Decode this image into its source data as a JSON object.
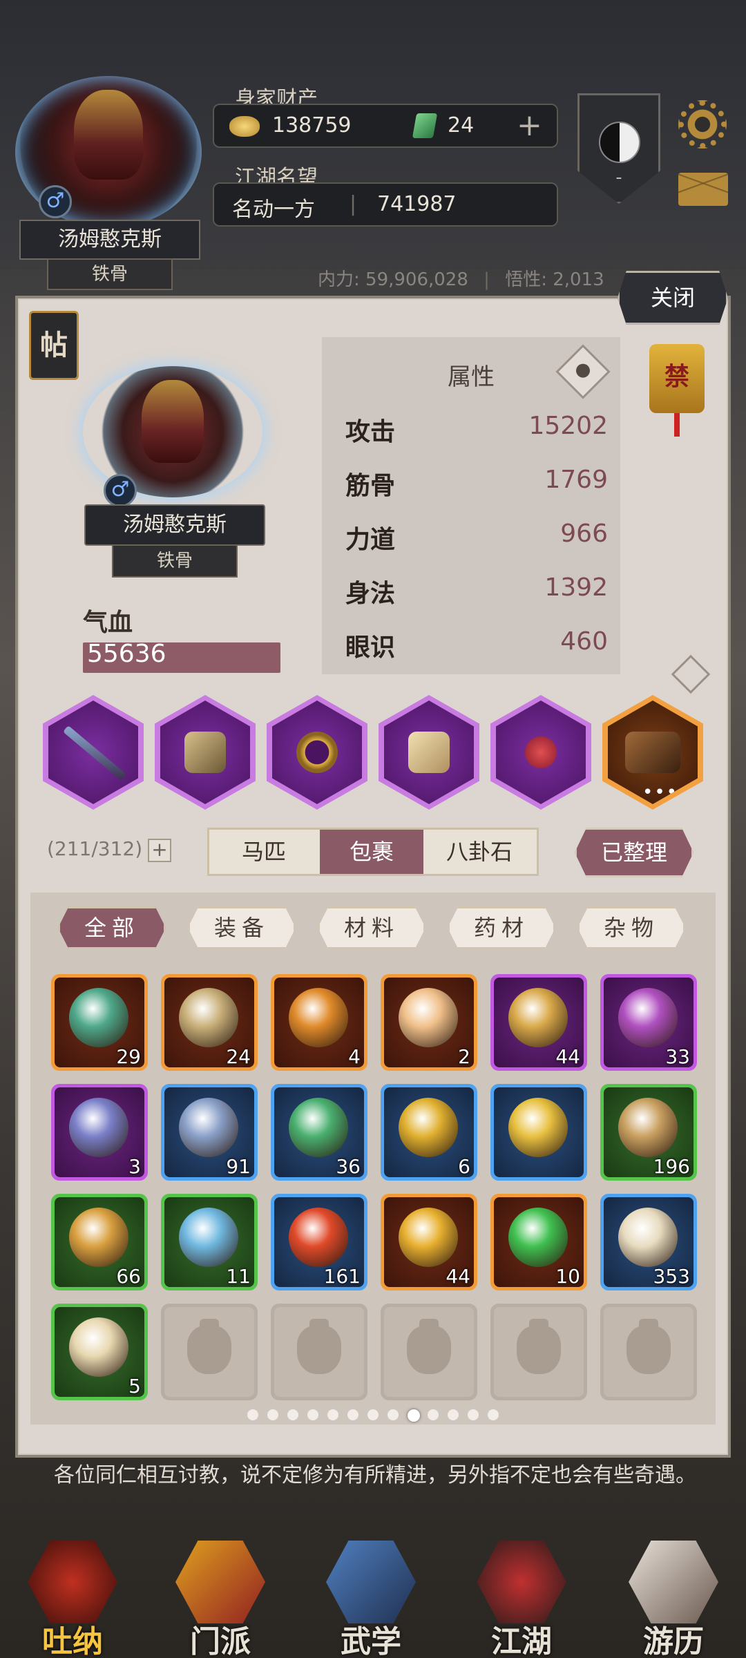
{
  "header": {
    "player_name": "汤姆憨克斯",
    "rank": "铁骨",
    "wealth_label": "身家财产",
    "gold": "138759",
    "jade": "24",
    "reputation_label": "江湖名望",
    "reputation_title": "名动一方",
    "reputation_value": "741987",
    "neili": "内力: 59,906,028",
    "wuxing": "悟性: 2,013",
    "taiji_value": "-"
  },
  "panel": {
    "close_label": "关闭",
    "tie_label": "帖",
    "forbid_label": "禁",
    "character_name": "汤姆憨克斯",
    "character_rank": "铁骨",
    "hp_label": "气血",
    "hp_value": "55636",
    "attributes_title": "属性",
    "attributes": [
      {
        "name": "攻击",
        "value": "15202"
      },
      {
        "name": "筋骨",
        "value": "1769"
      },
      {
        "name": "力道",
        "value": "966"
      },
      {
        "name": "身法",
        "value": "1392"
      },
      {
        "name": "眼识",
        "value": "460"
      }
    ],
    "equipment": [
      {
        "slot": "weapon",
        "quality": "purple",
        "icon": "spear-icon"
      },
      {
        "slot": "armor",
        "quality": "purple",
        "icon": "armor-icon"
      },
      {
        "slot": "ring",
        "quality": "purple",
        "icon": "ring-icon"
      },
      {
        "slot": "boots",
        "quality": "purple",
        "icon": "boots-icon"
      },
      {
        "slot": "accessory",
        "quality": "purple",
        "icon": "charm-icon"
      },
      {
        "slot": "mount",
        "quality": "orange",
        "icon": "horse-icon"
      }
    ],
    "more_dots": "•••"
  },
  "inventory": {
    "capacity": "(211/312)",
    "tabs": [
      "马匹",
      "包裹",
      "八卦石"
    ],
    "active_tab": 1,
    "sorted_label": "已整理",
    "filters": [
      "全部",
      "装备",
      "材料",
      "药材",
      "杂物"
    ],
    "active_filter": 0,
    "items": [
      {
        "quality": "orange",
        "count": "29",
        "color": "#4fa88a"
      },
      {
        "quality": "orange",
        "count": "24",
        "color": "#c9b07a"
      },
      {
        "quality": "orange",
        "count": "4",
        "color": "#e08a2a"
      },
      {
        "quality": "orange",
        "count": "2",
        "color": "#f0c08a"
      },
      {
        "quality": "purple",
        "count": "44",
        "color": "#d9a94a"
      },
      {
        "quality": "purple",
        "count": "33",
        "color": "#b050c0"
      },
      {
        "quality": "purple",
        "count": "3",
        "color": "#7a7fc8"
      },
      {
        "quality": "blue",
        "count": "91",
        "color": "#8aa0c8"
      },
      {
        "quality": "blue",
        "count": "36",
        "color": "#4ab070"
      },
      {
        "quality": "blue",
        "count": "6",
        "color": "#e0b030"
      },
      {
        "quality": "blue",
        "count": "",
        "color": "#e8c040"
      },
      {
        "quality": "green",
        "count": "196",
        "color": "#c9a060"
      },
      {
        "quality": "green",
        "count": "66",
        "color": "#d9a040"
      },
      {
        "quality": "green",
        "count": "11",
        "color": "#70b8e0"
      },
      {
        "quality": "blue",
        "count": "161",
        "color": "#e04a2a"
      },
      {
        "quality": "orange",
        "count": "44",
        "color": "#e8b030"
      },
      {
        "quality": "orange",
        "count": "10",
        "color": "#40c050"
      },
      {
        "quality": "blue",
        "count": "353",
        "color": "#e8dcc0"
      },
      {
        "quality": "green",
        "count": "5",
        "color": "#e8d8b0"
      },
      {
        "quality": "empty",
        "count": "",
        "color": ""
      },
      {
        "quality": "empty",
        "count": "",
        "color": ""
      },
      {
        "quality": "empty",
        "count": "",
        "color": ""
      },
      {
        "quality": "empty",
        "count": "",
        "color": ""
      },
      {
        "quality": "empty",
        "count": "",
        "color": ""
      }
    ],
    "page_count": 13,
    "active_page": 8
  },
  "notice": "各位同仁相互讨教，说不定修为有所精进，另外指不定也会有些奇遇。",
  "bottom_nav": [
    {
      "label": "吐纳",
      "icon": "meditation-icon",
      "active": true
    },
    {
      "label": "门派",
      "icon": "sect-banner-icon",
      "active": false
    },
    {
      "label": "武学",
      "icon": "martial-book-icon",
      "active": false
    },
    {
      "label": "江湖",
      "icon": "bamboo-hat-icon",
      "active": false
    },
    {
      "label": "游历",
      "icon": "travel-horse-icon",
      "active": false
    }
  ],
  "colors": {
    "accent": "#8a5a66",
    "orange": "#f39b36",
    "purple": "#c15ae0",
    "blue": "#4ea2f0",
    "green": "#56c44a"
  }
}
